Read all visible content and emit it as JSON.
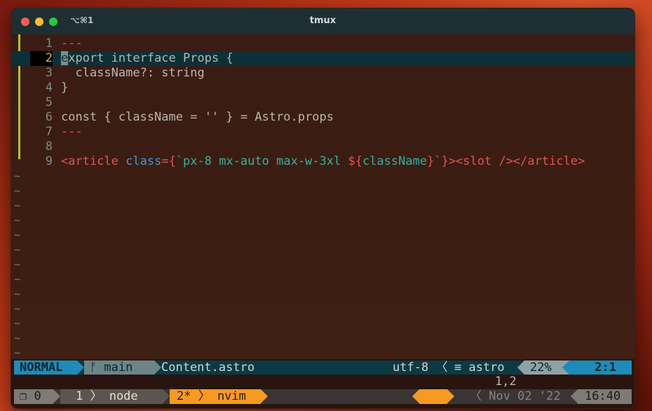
{
  "window": {
    "title": "tmux",
    "tab_shortcut": "⌥⌘1"
  },
  "editor": {
    "lines": [
      {
        "num": "1",
        "parts": [
          {
            "t": "---",
            "c": "c-red"
          }
        ]
      },
      {
        "num": "2",
        "current": true,
        "parts": [
          {
            "t": "e",
            "c": "cursor"
          },
          {
            "t": "xport interface Props {",
            "c": "c-kw"
          }
        ]
      },
      {
        "num": "3",
        "parts": [
          {
            "t": "  className?: string",
            "c": "c-kw"
          }
        ]
      },
      {
        "num": "4",
        "parts": [
          {
            "t": "}",
            "c": "c-kw"
          }
        ]
      },
      {
        "num": "5",
        "parts": []
      },
      {
        "num": "6",
        "parts": [
          {
            "t": "const { className = '' } = Astro.props",
            "c": "c-kw"
          }
        ]
      },
      {
        "num": "7",
        "parts": [
          {
            "t": "---",
            "c": "c-red"
          }
        ]
      },
      {
        "num": "8",
        "parts": []
      },
      {
        "num": "9",
        "parts": [
          {
            "t": "<article ",
            "c": "c-red"
          },
          {
            "t": "class",
            "c": "c-blue"
          },
          {
            "t": "=",
            "c": "c-red"
          },
          {
            "t": "{",
            "c": "c-red"
          },
          {
            "t": "`px-8 mx-auto max-w-3xl ",
            "c": "c-str"
          },
          {
            "t": "${",
            "c": "c-interp"
          },
          {
            "t": "className",
            "c": "c-teal"
          },
          {
            "t": "}",
            "c": "c-interp"
          },
          {
            "t": "`",
            "c": "c-str"
          },
          {
            "t": "}",
            "c": "c-red"
          },
          {
            "t": "><slot /></article>",
            "c": "c-red"
          }
        ]
      }
    ],
    "tilde": "~",
    "tilde_count": 13
  },
  "statusline": {
    "mode": "NORMAL",
    "branch": "ᚠ main",
    "filename": "Content.astro",
    "encoding": "utf-8",
    "filetype": "≡ astro",
    "percent": "22%",
    "position": "2:1",
    "sep_left": "〈",
    "sep_ft": "〈"
  },
  "cmdline": {
    "ruler": "1,2"
  },
  "tmux": {
    "session": "❐ 0",
    "window1": "1 〉 node",
    "window2": "2* 〉 nvim",
    "date": "〈 Nov 02 '22 〈",
    "time": "16:40"
  },
  "colors": {
    "accent_blue": "#1e8bb8",
    "accent_orange": "#f59a23",
    "diff_red": "#e05550"
  }
}
